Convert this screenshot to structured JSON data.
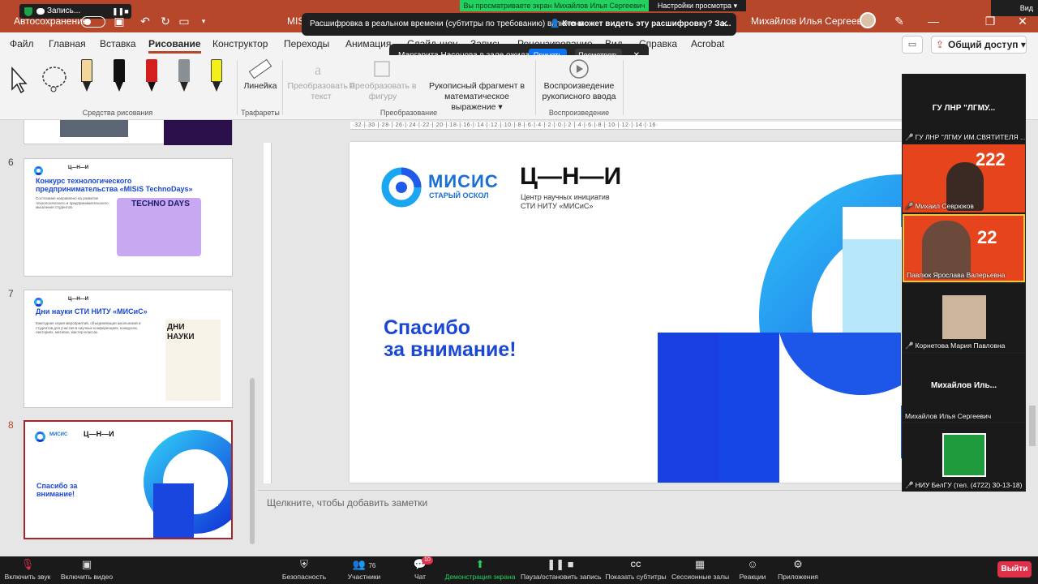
{
  "titlebar": {
    "autosave_label": "Автосохранение",
    "recording_label": "Запись...",
    "doc_title": "MISIS",
    "user_name": "Михайлов Илья Сергеевич"
  },
  "zoom_banners": {
    "sharing": "Вы просматриваете экран Михайлов Илья Сергеевич",
    "view_options": "Настройки просмотра",
    "view": "Вид",
    "caption": "Расшифровка в реальном времени (субтитры по требованию) включена",
    "caption_question": "Кто может видеть эту расшифровку? За...",
    "waiting": "Маргарита Насонова в зале ожидания",
    "accept": "Принять",
    "view_btn": "Посмотреть"
  },
  "ribbon": {
    "tabs": [
      "Файл",
      "Главная",
      "Вставка",
      "Рисование",
      "Конструктор",
      "Переходы",
      "Анимация",
      "Слайд-шоу",
      "Запись",
      "Рецензирование",
      "Вид",
      "Справка",
      "Acrobat"
    ],
    "active_tab": "Рисование",
    "share": "Общий доступ",
    "groups": {
      "tools": "Средства рисования",
      "stencils": "Трафареты",
      "convert": "Преобразование",
      "replay": "Воспроизведение"
    },
    "buttons": {
      "ruler": "Линейка",
      "to_text": "Преобразовать в текст",
      "to_shape": "Преобразовать в фигуру",
      "ink_math": "Рукописный фрагмент в математическое выражение",
      "ink_replay": "Воспроизведение рукописного ввода"
    }
  },
  "slides": {
    "s6": {
      "num": "6",
      "title": "Конкурс технологического предпринимательства «MISiS TechnoDays»",
      "body": "Состязание направлено на развитие технологического и предпринимательского мышления студентов.",
      "badge": "TECHNO DAYS"
    },
    "s7": {
      "num": "7",
      "title": "Дни науки СТИ НИТУ «МИСиС»",
      "body": "Ежегодная серия мероприятий, объединяющая школьников и студентов для участия в научных конференциях, конкурсах, лекториях, митапах, мастер-классах.",
      "badge": "ДНИ НАУКИ"
    },
    "s8": {
      "num": "8",
      "thanks": "Спасибо за внимание!"
    }
  },
  "main_slide": {
    "logo_name": "МИСИС",
    "logo_sub": "СТАРЫЙ ОСКОЛ",
    "cni": "Ц—Н—И",
    "cni_line1": "Центр научных инициатив",
    "cni_line2": "СТИ НИТУ «МИСиС»",
    "thanks_line1": "Спасибо",
    "thanks_line2": "за внимание!"
  },
  "notes_placeholder": "Щелкните, чтобы добавить заметки",
  "participants": [
    {
      "label": "ГУ ЛНР \"ЛГМУ...",
      "kind": "text"
    },
    {
      "label": "ГУ ЛНР \"ЛГМУ ИМ.СВЯТИТЕЛЯ ...",
      "kind": "video",
      "muted": true
    },
    {
      "label": "Михаил Севрюков",
      "kind": "video",
      "muted": true
    },
    {
      "label": "Павлюк Ярослава Валерьевна",
      "kind": "video",
      "muted": false
    },
    {
      "label": "Корнетова Мария Павловна",
      "kind": "photo",
      "muted": true
    },
    {
      "label": "Михайлов Иль...",
      "sub": "Михайлов Илья Сергеевич",
      "kind": "text"
    },
    {
      "label": "НИУ БелГУ (тел. (4722) 30-13-18)",
      "kind": "logo",
      "muted": true
    }
  ],
  "zoom_toolbar": {
    "mute": "Включить звук",
    "video": "Включить видео",
    "security": "Безопасность",
    "participants": "Участники",
    "participants_count": "76",
    "chat": "Чат",
    "chat_count": "10",
    "share": "Демонстрация экрана",
    "pause": "Пауза/остановить запись",
    "cc": "Показать субтитры",
    "rooms": "Сессионные залы",
    "reactions": "Реакции",
    "apps": "Приложения",
    "leave": "Выйти"
  },
  "colors": {
    "ppt_red": "#b7472a",
    "brand_blue": "#1a47d6",
    "zoom_green": "#23d160",
    "zoom_red": "#e0314b"
  }
}
